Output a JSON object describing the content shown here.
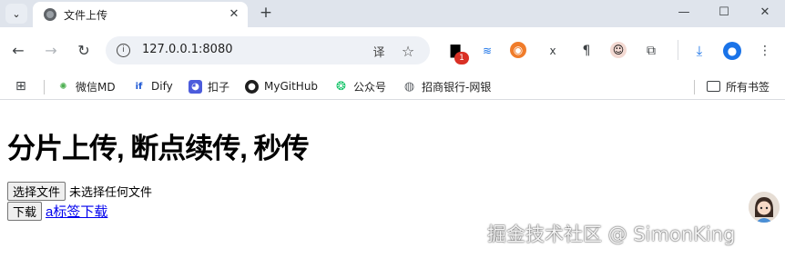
{
  "browser": {
    "tab_title": "文件上传",
    "url": "127.0.0.1:8080",
    "extension_badge": "1",
    "bookmarks": [
      {
        "label": "微信MD",
        "icon": "wechat-md-icon"
      },
      {
        "label": "Dify",
        "icon": "dify-icon"
      },
      {
        "label": "扣子",
        "icon": "coze-icon"
      },
      {
        "label": "MyGitHub",
        "icon": "github-icon"
      },
      {
        "label": "公众号",
        "icon": "wechat-official-icon"
      },
      {
        "label": "招商银行-网银",
        "icon": "globe-icon"
      }
    ],
    "all_bookmarks_label": "所有书签"
  },
  "page": {
    "title": "分片上传, 断点续传, 秒传",
    "choose_file_label": "选择文件",
    "file_status": "未选择任何文件",
    "download_button_label": "下载",
    "download_link_label": "a标签下载"
  },
  "watermark": {
    "text": "掘金技术社区 @ SimonKing"
  }
}
